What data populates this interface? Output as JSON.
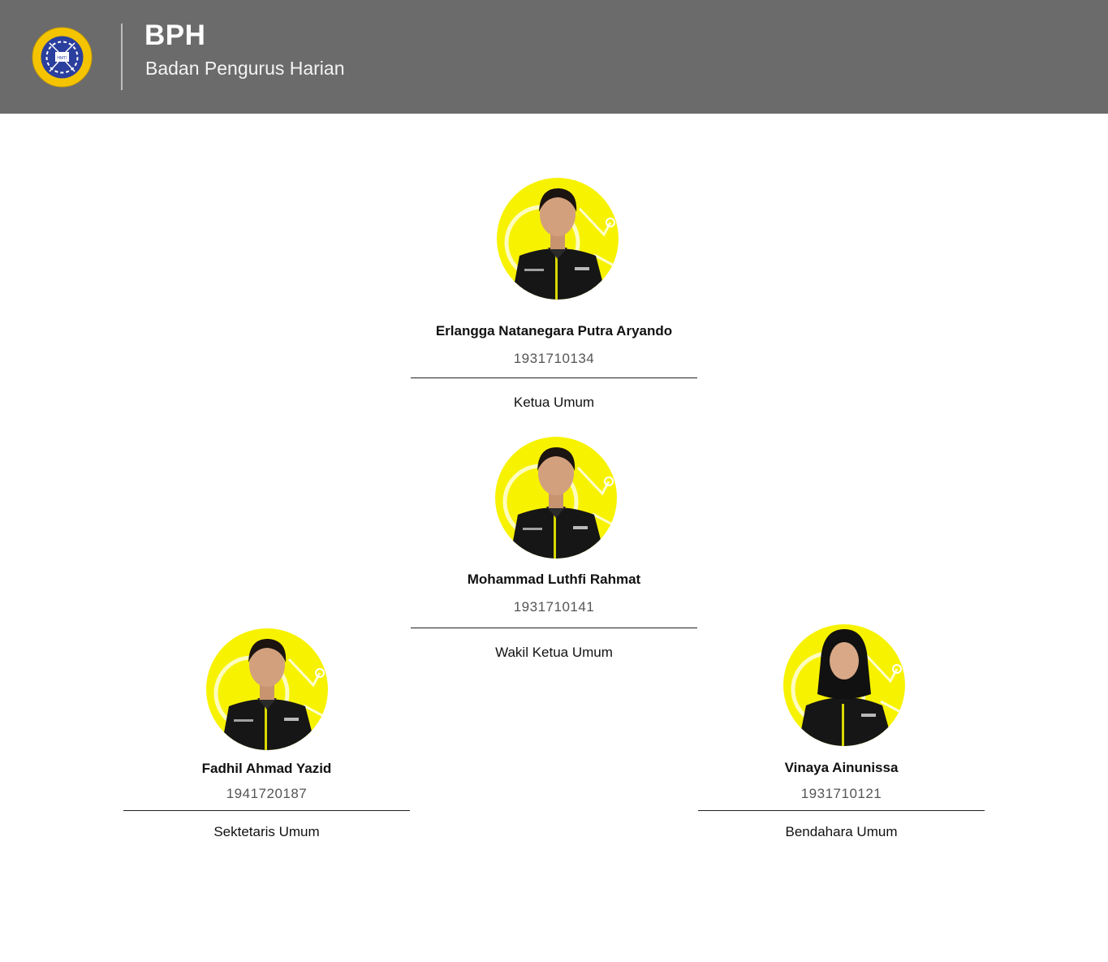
{
  "header": {
    "title": "BPH",
    "subtitle": "Badan Pengurus Harian",
    "logo_icon": "hmti-polinema-logo-icon",
    "background": "#6b6b6b"
  },
  "accent_color": "#f7f200",
  "members": [
    {
      "name": "Erlangga Natanegara Putra Aryando",
      "nim": "1931710134",
      "role": "Ketua Umum",
      "avatar_icon": "member-photo"
    },
    {
      "name": "Mohammad Luthfi Rahmat",
      "nim": "1931710141",
      "role": "Wakil Ketua Umum",
      "avatar_icon": "member-photo"
    },
    {
      "name": "Fadhil Ahmad Yazid",
      "nim": "1941720187",
      "role": "Sektetaris Umum",
      "avatar_icon": "member-photo"
    },
    {
      "name": "Vinaya Ainunissa",
      "nim": "1931710121",
      "role": "Bendahara Umum",
      "avatar_icon": "member-photo"
    }
  ]
}
